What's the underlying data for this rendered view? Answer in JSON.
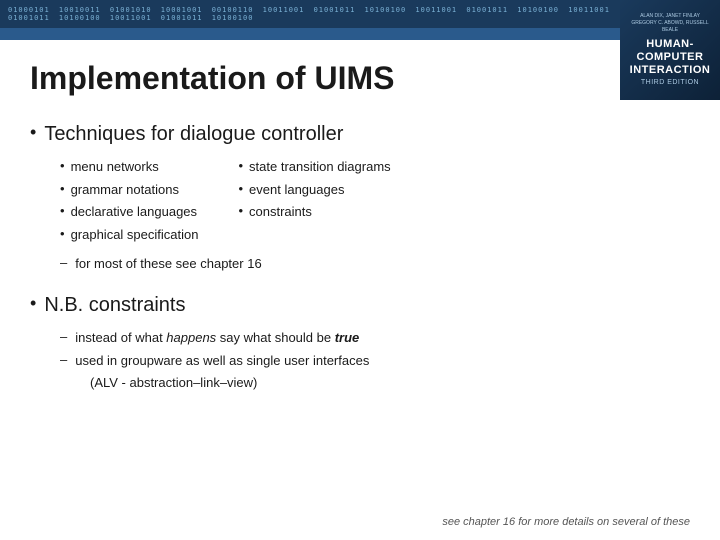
{
  "top_banner": {
    "text": "01000101 10010011 01001010 10001001 00100110 10011001 01001011 10100100 10011001 01001011 10100100 10011001 01001011 10100100 10011001 01001011 10100100"
  },
  "book_cover": {
    "authors": "ALAN DIX, JANET FINLAY\nGREGORY D. ABOWD, RUSSELL BEALE",
    "title_line1": "HUMAN-COMPUTER",
    "title_line2": "INTERACTION",
    "edition": "THIRD EDITION"
  },
  "page_title": "Implementation of UIMS",
  "section1": {
    "main_label": "Techniques for dialogue controller",
    "col1": {
      "items": [
        "menu networks",
        "grammar notations",
        "declarative languages",
        "graphical specification"
      ]
    },
    "col2": {
      "items": [
        "state transition diagrams",
        "event languages",
        "constraints"
      ]
    },
    "dash_item": "for most of these see chapter 16"
  },
  "section2": {
    "main_label": "N.B. constraints",
    "dash_items": [
      {
        "prefix": "instead of what ",
        "italic": "happens",
        "middle": " say what should be ",
        "bold_italic": "true"
      },
      {
        "text": "used in groupware as well as single user interfaces"
      }
    ],
    "sub_note": "(ALV - abstraction–link–view)"
  },
  "bottom_note": "see chapter 16 for more details on several of these",
  "bullets": {
    "dot": "•",
    "dash": "–"
  }
}
